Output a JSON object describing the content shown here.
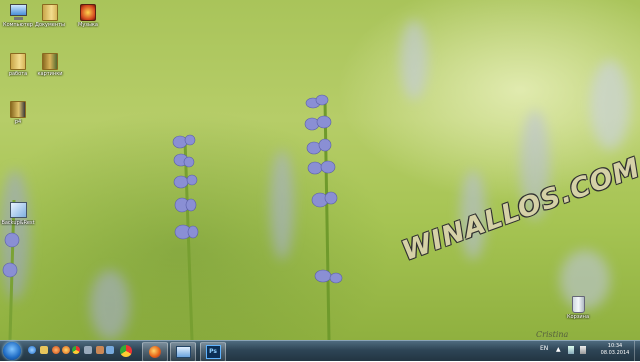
{
  "desktop": {
    "icons": [
      {
        "label": "Компьютер",
        "icon": "computer-icon"
      },
      {
        "label": "Документы",
        "icon": "folder-icon"
      },
      {
        "label": "Музыка",
        "icon": "music-folder-icon"
      },
      {
        "label": "работа",
        "icon": "folder-icon"
      },
      {
        "label": "картинки",
        "icon": "folder-icon"
      },
      {
        "label": "р4",
        "icon": "folder-icon"
      },
      {
        "label": "Backup&Rest",
        "icon": "shortcut-icon"
      },
      {
        "label": "Корзина",
        "icon": "recycle-bin-icon"
      }
    ]
  },
  "watermark": {
    "text": "WINALLOS.COM"
  },
  "signature": {
    "text": "Cristina"
  },
  "taskbar": {
    "quick_launch": [
      "ie-icon",
      "folder-icon",
      "media-icon",
      "firefox-icon",
      "chrome-icon",
      "settings-icon"
    ],
    "pinned": [
      "chrome-icon",
      "firefox-icon",
      "explorer-icon",
      "photoshop-icon"
    ],
    "photoshop_label": "Ps",
    "language": "EN",
    "clock": {
      "time": "10:34",
      "date": "08.03.2014"
    }
  },
  "colors": {
    "taskbar": "#2e4556",
    "accent": "#1f6cc4",
    "photoshop": "#0b2f56"
  }
}
